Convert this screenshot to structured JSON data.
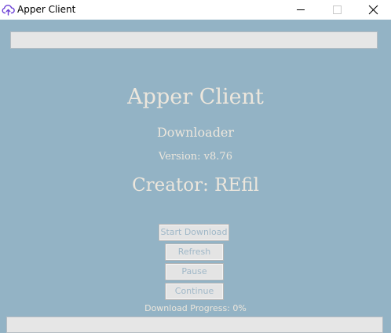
{
  "window": {
    "title": "Apper Client",
    "app_icon": "cloud-upload-icon",
    "controls": [
      "minimize-icon",
      "maximize-icon",
      "close-icon"
    ]
  },
  "top_field": {
    "value": ""
  },
  "main": {
    "app_name": "Apper Client",
    "subtitle": "Downloader",
    "version": "Version: v8.76",
    "creator": "Creator: REfil"
  },
  "buttons": {
    "start_download": "Start Download",
    "refresh": "Refresh",
    "pause": "Pause",
    "continue": "Continue"
  },
  "progress": {
    "label": "Download Progress: 0%",
    "fraction": 0
  },
  "colors": {
    "background": "#93b3c5",
    "text": "#ece6dc",
    "button_text": "#a0b8c8"
  }
}
